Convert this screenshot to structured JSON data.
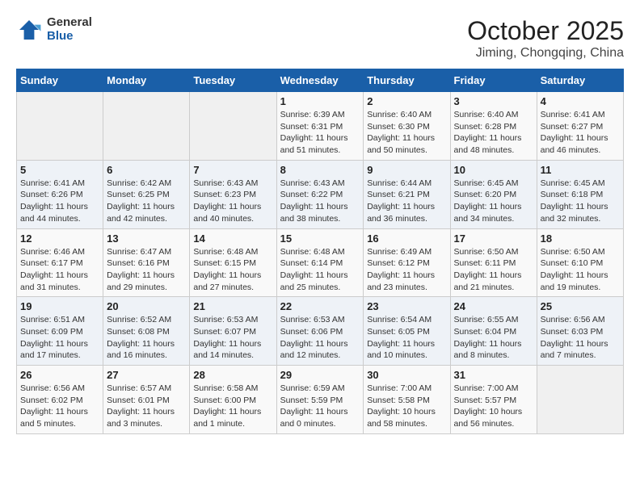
{
  "logo": {
    "general": "General",
    "blue": "Blue"
  },
  "title": "October 2025",
  "location": "Jiming, Chongqing, China",
  "weekdays": [
    "Sunday",
    "Monday",
    "Tuesday",
    "Wednesday",
    "Thursday",
    "Friday",
    "Saturday"
  ],
  "weeks": [
    [
      {
        "day": "",
        "info": ""
      },
      {
        "day": "",
        "info": ""
      },
      {
        "day": "",
        "info": ""
      },
      {
        "day": "1",
        "info": "Sunrise: 6:39 AM\nSunset: 6:31 PM\nDaylight: 11 hours\nand 51 minutes."
      },
      {
        "day": "2",
        "info": "Sunrise: 6:40 AM\nSunset: 6:30 PM\nDaylight: 11 hours\nand 50 minutes."
      },
      {
        "day": "3",
        "info": "Sunrise: 6:40 AM\nSunset: 6:28 PM\nDaylight: 11 hours\nand 48 minutes."
      },
      {
        "day": "4",
        "info": "Sunrise: 6:41 AM\nSunset: 6:27 PM\nDaylight: 11 hours\nand 46 minutes."
      }
    ],
    [
      {
        "day": "5",
        "info": "Sunrise: 6:41 AM\nSunset: 6:26 PM\nDaylight: 11 hours\nand 44 minutes."
      },
      {
        "day": "6",
        "info": "Sunrise: 6:42 AM\nSunset: 6:25 PM\nDaylight: 11 hours\nand 42 minutes."
      },
      {
        "day": "7",
        "info": "Sunrise: 6:43 AM\nSunset: 6:23 PM\nDaylight: 11 hours\nand 40 minutes."
      },
      {
        "day": "8",
        "info": "Sunrise: 6:43 AM\nSunset: 6:22 PM\nDaylight: 11 hours\nand 38 minutes."
      },
      {
        "day": "9",
        "info": "Sunrise: 6:44 AM\nSunset: 6:21 PM\nDaylight: 11 hours\nand 36 minutes."
      },
      {
        "day": "10",
        "info": "Sunrise: 6:45 AM\nSunset: 6:20 PM\nDaylight: 11 hours\nand 34 minutes."
      },
      {
        "day": "11",
        "info": "Sunrise: 6:45 AM\nSunset: 6:18 PM\nDaylight: 11 hours\nand 32 minutes."
      }
    ],
    [
      {
        "day": "12",
        "info": "Sunrise: 6:46 AM\nSunset: 6:17 PM\nDaylight: 11 hours\nand 31 minutes."
      },
      {
        "day": "13",
        "info": "Sunrise: 6:47 AM\nSunset: 6:16 PM\nDaylight: 11 hours\nand 29 minutes."
      },
      {
        "day": "14",
        "info": "Sunrise: 6:48 AM\nSunset: 6:15 PM\nDaylight: 11 hours\nand 27 minutes."
      },
      {
        "day": "15",
        "info": "Sunrise: 6:48 AM\nSunset: 6:14 PM\nDaylight: 11 hours\nand 25 minutes."
      },
      {
        "day": "16",
        "info": "Sunrise: 6:49 AM\nSunset: 6:12 PM\nDaylight: 11 hours\nand 23 minutes."
      },
      {
        "day": "17",
        "info": "Sunrise: 6:50 AM\nSunset: 6:11 PM\nDaylight: 11 hours\nand 21 minutes."
      },
      {
        "day": "18",
        "info": "Sunrise: 6:50 AM\nSunset: 6:10 PM\nDaylight: 11 hours\nand 19 minutes."
      }
    ],
    [
      {
        "day": "19",
        "info": "Sunrise: 6:51 AM\nSunset: 6:09 PM\nDaylight: 11 hours\nand 17 minutes."
      },
      {
        "day": "20",
        "info": "Sunrise: 6:52 AM\nSunset: 6:08 PM\nDaylight: 11 hours\nand 16 minutes."
      },
      {
        "day": "21",
        "info": "Sunrise: 6:53 AM\nSunset: 6:07 PM\nDaylight: 11 hours\nand 14 minutes."
      },
      {
        "day": "22",
        "info": "Sunrise: 6:53 AM\nSunset: 6:06 PM\nDaylight: 11 hours\nand 12 minutes."
      },
      {
        "day": "23",
        "info": "Sunrise: 6:54 AM\nSunset: 6:05 PM\nDaylight: 11 hours\nand 10 minutes."
      },
      {
        "day": "24",
        "info": "Sunrise: 6:55 AM\nSunset: 6:04 PM\nDaylight: 11 hours\nand 8 minutes."
      },
      {
        "day": "25",
        "info": "Sunrise: 6:56 AM\nSunset: 6:03 PM\nDaylight: 11 hours\nand 7 minutes."
      }
    ],
    [
      {
        "day": "26",
        "info": "Sunrise: 6:56 AM\nSunset: 6:02 PM\nDaylight: 11 hours\nand 5 minutes."
      },
      {
        "day": "27",
        "info": "Sunrise: 6:57 AM\nSunset: 6:01 PM\nDaylight: 11 hours\nand 3 minutes."
      },
      {
        "day": "28",
        "info": "Sunrise: 6:58 AM\nSunset: 6:00 PM\nDaylight: 11 hours\nand 1 minute."
      },
      {
        "day": "29",
        "info": "Sunrise: 6:59 AM\nSunset: 5:59 PM\nDaylight: 11 hours\nand 0 minutes."
      },
      {
        "day": "30",
        "info": "Sunrise: 7:00 AM\nSunset: 5:58 PM\nDaylight: 10 hours\nand 58 minutes."
      },
      {
        "day": "31",
        "info": "Sunrise: 7:00 AM\nSunset: 5:57 PM\nDaylight: 10 hours\nand 56 minutes."
      },
      {
        "day": "",
        "info": ""
      }
    ]
  ]
}
